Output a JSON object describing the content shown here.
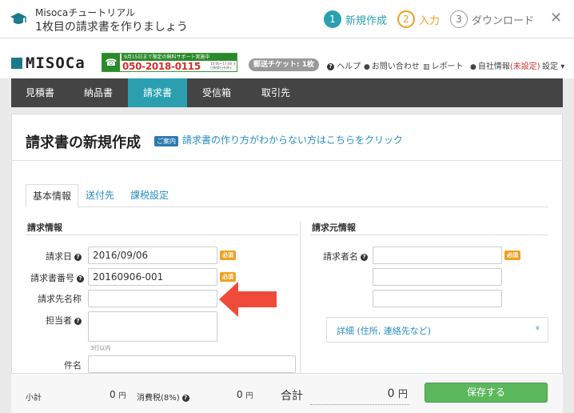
{
  "tutorial": {
    "title": "Misocaチュートリアル",
    "subtitle": "1枚目の請求書を作りましょう",
    "steps": [
      {
        "num": "1",
        "label": "新規作成"
      },
      {
        "num": "2",
        "label": "入力"
      },
      {
        "num": "3",
        "label": "ダウンロード"
      }
    ],
    "close": "✕"
  },
  "header": {
    "logo": "MISOCa",
    "support": {
      "notice": "9月15日まで限定の無料サポート実施中",
      "phone": "050-2018-0115",
      "hours": "10:00〜17:00 土日祝祭日を除く"
    },
    "ticket": "郵送チケット: 1枚",
    "links": {
      "help": "ヘルプ",
      "contact": "お問い合わせ",
      "report": "レポート",
      "company": "自社情報",
      "company_status": "(未設定)",
      "settings": "設定"
    }
  },
  "nav": {
    "items": [
      "見積書",
      "納品書",
      "請求書",
      "受信箱",
      "取引先"
    ],
    "active": "請求書"
  },
  "page": {
    "title": "請求書の新規作成",
    "guide_badge": "ご案内",
    "guide_link": "請求書の作り方がわからない方はこちらをクリック"
  },
  "tabs": [
    "基本情報",
    "送付先",
    "課税設定"
  ],
  "billing_info": {
    "section_title": "請求情報",
    "date_label": "請求日",
    "date_value": "2016/09/06",
    "number_label": "請求書番号",
    "number_value": "20160906-001",
    "client_label": "請求先名称",
    "client_value": "",
    "person_label": "担当者",
    "person_value": "",
    "person_hint": "3行以内",
    "subject_label": "件名",
    "subject_value": "",
    "required": "必須"
  },
  "issuer_info": {
    "section_title": "請求元情報",
    "name_label": "請求者名",
    "name_value": "",
    "line2_value": "",
    "line3_value": "",
    "required": "必須",
    "detail_label": "詳細 (住所, 連絡先など)",
    "detail_chevron": "»"
  },
  "footer": {
    "subtotal_label": "小計",
    "subtotal_value": "0",
    "subtotal_unit": "円",
    "tax_label": "消費税(8%)",
    "tax_value": "0",
    "tax_unit": "円",
    "total_label": "合計",
    "total_value": "0",
    "total_unit": "円",
    "save_label": "保存する"
  },
  "colors": {
    "accent": "#2a9fb0",
    "step_input": "#f0a020",
    "required": "#f0a020",
    "save": "#5cb85c",
    "nav": "#444444",
    "arrow": "#f04a3a"
  }
}
